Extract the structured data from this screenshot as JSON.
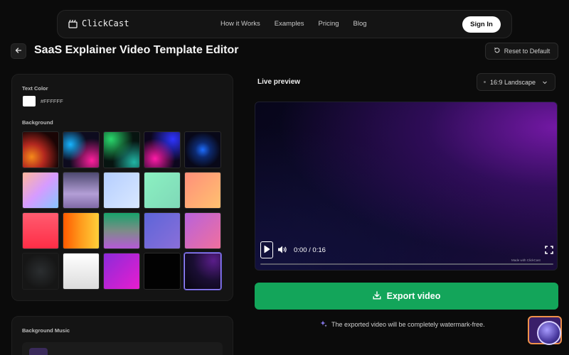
{
  "header": {
    "logo_text": "ClickCast",
    "nav": [
      "How it Works",
      "Examples",
      "Pricing",
      "Blog"
    ],
    "signin_label": "Sign In"
  },
  "page": {
    "title": "SaaS Explainer Video Template Editor",
    "reset_label": "Reset to Default"
  },
  "editor": {
    "text_color_label": "Text Color",
    "text_color_value": "#FFFFFF",
    "background_label": "Background",
    "background_swatch_count": 20,
    "selected_background_index": 19,
    "background_music_label": "Background Music"
  },
  "preview": {
    "label": "Live preview",
    "aspect_ratio": "16:9 Landscape",
    "time": "0:00 / 0:16",
    "watermark": "Made with ClickCast",
    "progress": 0
  },
  "export": {
    "button_label": "Export video",
    "note": "The exported video  will be completely watermark-free."
  },
  "colors": {
    "accent_green": "#13a55a",
    "page_bg": "#0b0b0b",
    "panel_bg": "#141414"
  }
}
